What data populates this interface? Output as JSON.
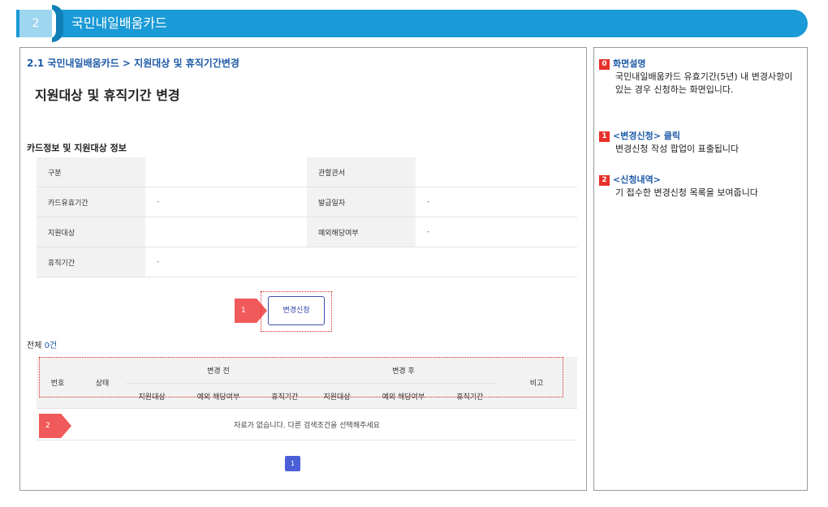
{
  "header": {
    "number": "2",
    "title": "국민내일배움카드"
  },
  "main": {
    "breadcrumb": "2.1 국민내일배움카드 > 지원대상 및 휴직기간변경",
    "page_title": "지원대상 및 휴직기간 변경",
    "section_title": "카드정보 및 지원대상 정보",
    "info_rows": [
      {
        "label1": "구분",
        "value1": "",
        "label2": "관할관서",
        "value2": ""
      },
      {
        "label1": "카드유효기간",
        "value1": "-",
        "label2": "발급일자",
        "value2": "-"
      },
      {
        "label1": "지원대상",
        "value1": "",
        "label2": "예외해당여부",
        "value2": "-"
      },
      {
        "label1": "휴직기간",
        "value1": "-",
        "label2": "",
        "value2": ""
      }
    ],
    "change_button": "변경신청",
    "callout1": "1",
    "total_prefix": "전체 ",
    "total_count": "0건",
    "list": {
      "col_no": "번호",
      "col_status": "상태",
      "group_before": "변경 전",
      "group_after": "변경 후",
      "col_remark": "비고",
      "sub_target": "지원대상",
      "sub_exception": "예외 해당여부",
      "sub_leave": "휴직기간",
      "empty_message": "자료가 없습니다. 다른 검색조건을 선택해주세요"
    },
    "callout2": "2",
    "page_number": "1"
  },
  "side": {
    "notes": [
      {
        "badge": "0",
        "title": "화면설명",
        "body": "국민내일배움카드 유효기간(5년) 내 변경사항이 있는 경우 신청하는 화면입니다."
      },
      {
        "badge": "1",
        "title": "<변경신청> 클릭",
        "body": "변경신청 작성 팝업이 표출됩니다"
      },
      {
        "badge": "2",
        "title": "<신청내역>",
        "body": "기 접수한 변경신청 목록을 보여줍니다"
      }
    ]
  },
  "colors": {
    "header_bar": "#1a9ad6",
    "accent_blue": "#1d5aa8",
    "callout_red": "#f15a5a",
    "badge_red": "#e8302b",
    "pager_blue": "#4b5fd6"
  }
}
